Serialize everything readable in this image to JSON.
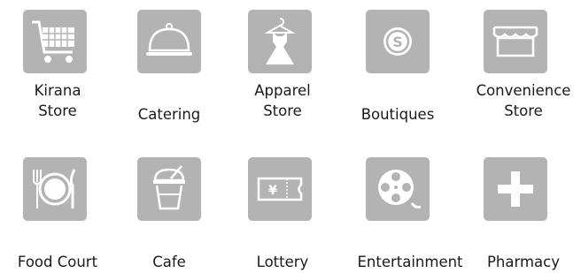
{
  "colors": {
    "tile_bg": "#b3b3b3",
    "glyph": "#ffffff",
    "label": "#1a1a1a"
  },
  "categories": [
    {
      "id": "kirana-store",
      "label_lines": [
        "Kirana",
        "Store"
      ],
      "icon": "shopping-cart-icon"
    },
    {
      "id": "catering",
      "label_lines": [
        "Catering"
      ],
      "icon": "food-cloche-icon"
    },
    {
      "id": "apparel-store",
      "label_lines": [
        "Apparel",
        "Store"
      ],
      "icon": "dress-hanger-icon"
    },
    {
      "id": "boutiques",
      "label_lines": [
        "Boutiques"
      ],
      "icon": "sparkle-badge-icon"
    },
    {
      "id": "convenience-store",
      "label_lines": [
        "Convenience",
        "Store"
      ],
      "icon": "storefront-icon"
    },
    {
      "id": "food-court",
      "label_lines": [
        "Food Court"
      ],
      "icon": "plate-cutlery-icon"
    },
    {
      "id": "cafe",
      "label_lines": [
        "Cafe"
      ],
      "icon": "drink-cup-icon"
    },
    {
      "id": "lottery",
      "label_lines": [
        "Lottery"
      ],
      "icon": "lottery-ticket-icon"
    },
    {
      "id": "entertainment",
      "label_lines": [
        "Entertainment"
      ],
      "icon": "film-reel-icon"
    },
    {
      "id": "pharmacy",
      "label_lines": [
        "Pharmacy"
      ],
      "icon": "medical-cross-icon"
    }
  ]
}
